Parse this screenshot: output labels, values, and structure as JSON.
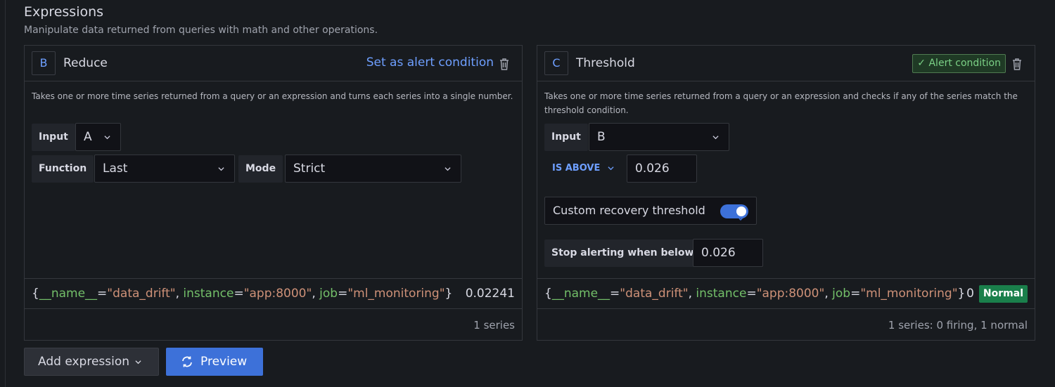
{
  "section": {
    "title": "Expressions",
    "description": "Manipulate data returned from queries with math and other operations."
  },
  "expressions": [
    {
      "ref_id": "B",
      "type": "Reduce",
      "set_alert_label": "Set as alert condition",
      "description": "Takes one or more time series returned from a query or an expression and turns each series into a single number.",
      "input_label": "Input",
      "input_value": "A",
      "function_label": "Function",
      "function_value": "Last",
      "mode_label": "Mode",
      "mode_value": "Strict",
      "result": {
        "name_key": "__name__",
        "name_value": "\"data_drift\"",
        "instance_key": "instance",
        "instance_value": "\"app:8000\"",
        "job_key": "job",
        "job_value": "\"ml_monitoring\"",
        "value": "0.02241"
      },
      "footer": "1 series"
    },
    {
      "ref_id": "C",
      "type": "Threshold",
      "alert_condition_label": "Alert condition",
      "description": "Takes one or more time series returned from a query or an expression and checks if any of the series match the threshold condition.",
      "input_label": "Input",
      "input_value": "B",
      "operator": "IS ABOVE",
      "threshold_value": "0.026",
      "recovery_label": "Custom recovery threshold",
      "recovery_enabled": true,
      "stop_label": "Stop alerting when below",
      "stop_value": "0.026",
      "result": {
        "name_key": "__name__",
        "name_value": "\"data_drift\"",
        "instance_key": "instance",
        "instance_value": "\"app:8000\"",
        "job_key": "job",
        "job_value": "\"ml_monitoring\"",
        "value": "0",
        "state": "Normal"
      },
      "footer": "1 series: 0 firing, 1 normal"
    }
  ],
  "actions": {
    "add_expression": "Add expression",
    "preview": "Preview"
  },
  "colors": {
    "accent": "#3d71d9",
    "link": "#6e9fff",
    "label_key": "#73bf69",
    "label_value": "#ce9178",
    "normal_badge": "#1a7f4b"
  }
}
